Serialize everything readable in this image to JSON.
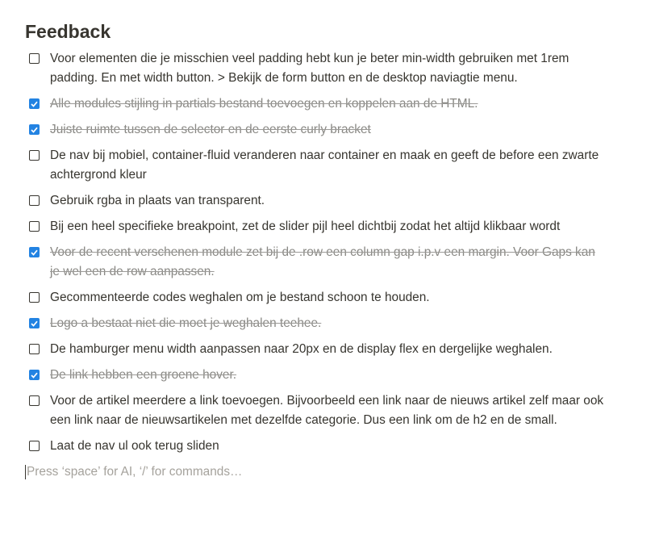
{
  "heading": "Feedback",
  "colors": {
    "checkbox_checked": "#2383e2",
    "text": "#37352f",
    "done_text": "#898884",
    "placeholder": "#a5a29c"
  },
  "todos": [
    {
      "text": "Voor elementen die je misschien veel padding hebt kun je beter min-width gebruiken met 1rem padding. En met width button. > Bekijk de form button en de desktop naviagtie menu.",
      "checked": false
    },
    {
      "text": "Alle modules stijling in partials bestand toevoegen en koppelen aan de HTML.",
      "checked": true
    },
    {
      "text": "Juiste ruimte tussen de selector en de eerste curly bracket",
      "checked": true
    },
    {
      "text": "De nav bij mobiel, container-fluid veranderen naar container en maak en geeft de before een zwarte achtergrond kleur",
      "checked": false
    },
    {
      "text": "Gebruik rgba in plaats van transparent.",
      "checked": false
    },
    {
      "text": "Bij een heel specifieke breakpoint, zet de slider pijl heel dichtbij zodat het altijd klikbaar wordt",
      "checked": false
    },
    {
      "text": "Voor de recent verschenen module zet bij de .row een column gap i.p.v een margin. Voor Gaps kan je wel een de row aanpassen.",
      "checked": true
    },
    {
      "text": "Gecommenteerde codes weghalen om je bestand schoon te houden.",
      "checked": false
    },
    {
      "text": "Logo a bestaat niet die moet je weghalen teehee.",
      "checked": true
    },
    {
      "text": "De hamburger menu width aanpassen naar 20px en de display flex  en dergelijke weghalen.",
      "checked": false
    },
    {
      "text": "De link hebben een groene hover.",
      "checked": true
    },
    {
      "text": "Voor de artikel meerdere a link toevoegen. Bijvoorbeeld een link naar de nieuws artikel zelf maar ook een link naar de nieuwsartikelen met dezelfde categorie. Dus een link om de h2 en de small.",
      "checked": false
    },
    {
      "text": "Laat de nav ul ook terug sliden",
      "checked": false
    }
  ],
  "placeholder": "Press ‘space’ for AI, ‘/’ for commands…"
}
